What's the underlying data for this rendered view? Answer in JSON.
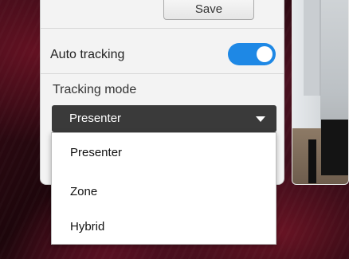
{
  "panel": {
    "save_label": "Save",
    "auto_tracking_label": "Auto tracking",
    "auto_tracking_on": true,
    "tracking_mode_label": "Tracking mode",
    "selected_mode": "Presenter"
  },
  "dropdown": {
    "options": [
      "Presenter",
      "Zone",
      "Hybrid"
    ]
  },
  "colors": {
    "toggle_on": "#1e88e5",
    "select_bg": "#3a3a3a",
    "background": "#2a0a10"
  },
  "icons": {
    "caret": "chevron-down-icon"
  }
}
